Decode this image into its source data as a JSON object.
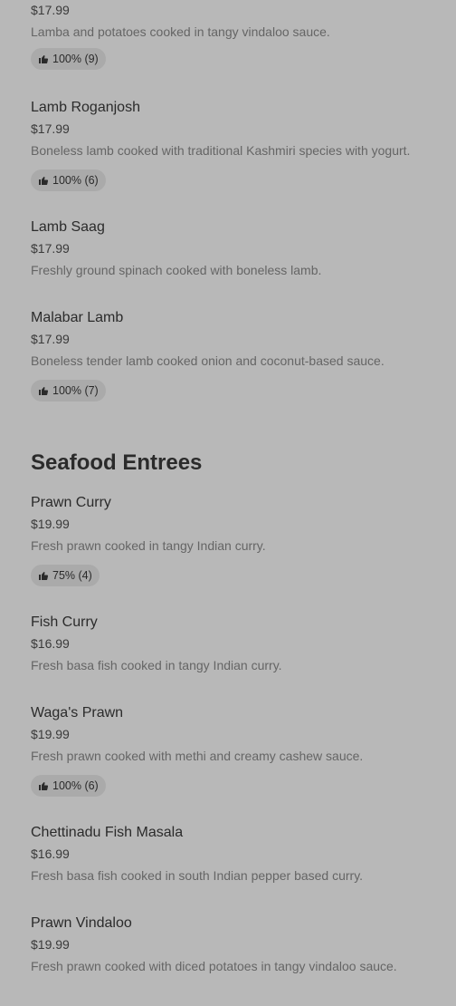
{
  "partial_item": {
    "price": "$17.99",
    "description": "Lamba and potatoes cooked in tangy vindaloo sauce.",
    "rating": "100% (9)"
  },
  "lamb_items": [
    {
      "name": "Lamb Roganjosh",
      "price": "$17.99",
      "description": "Boneless lamb cooked with traditional Kashmiri species with yogurt.",
      "rating": "100% (6)"
    },
    {
      "name": "Lamb Saag",
      "price": "$17.99",
      "description": "Freshly ground spinach cooked with boneless lamb."
    },
    {
      "name": "Malabar Lamb",
      "price": "$17.99",
      "description": "Boneless tender lamb cooked onion and coconut-based sauce.",
      "rating": "100% (7)"
    }
  ],
  "seafood_section": {
    "title": "Seafood Entrees",
    "items": [
      {
        "name": "Prawn Curry",
        "price": "$19.99",
        "description": "Fresh prawn cooked in tangy Indian curry.",
        "rating": "75% (4)"
      },
      {
        "name": "Fish Curry",
        "price": "$16.99",
        "description": "Fresh basa fish cooked in tangy Indian curry."
      },
      {
        "name": "Waga's Prawn",
        "price": "$19.99",
        "description": "Fresh prawn cooked with methi and creamy cashew sauce.",
        "rating": "100% (6)"
      },
      {
        "name": "Chettinadu Fish Masala",
        "price": "$16.99",
        "description": "Fresh basa fish cooked in south Indian pepper based curry."
      },
      {
        "name": "Prawn Vindaloo",
        "price": "$19.99",
        "description": "Fresh prawn cooked with diced potatoes in tangy vindaloo sauce."
      }
    ]
  },
  "icons": {
    "rating": "thumbs-up-icon"
  }
}
